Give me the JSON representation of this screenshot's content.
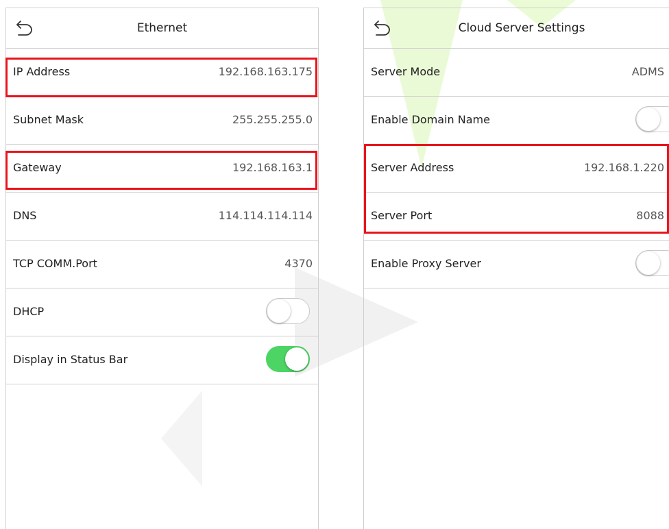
{
  "colors": {
    "highlight": "#e8141b",
    "toggle_on": "#4cd464",
    "divider": "#cfcfcf"
  },
  "left_panel": {
    "title": "Ethernet",
    "back_icon": "back-arrow-icon",
    "rows": [
      {
        "label": "IP Address",
        "value": "192.168.163.175",
        "highlighted": true
      },
      {
        "label": "Subnet Mask",
        "value": "255.255.255.0"
      },
      {
        "label": "Gateway",
        "value": "192.168.163.1",
        "highlighted": true
      },
      {
        "label": "DNS",
        "value": "114.114.114.114"
      },
      {
        "label": "TCP COMM.Port",
        "value": "4370"
      },
      {
        "label": "DHCP",
        "toggle": "off"
      },
      {
        "label": "Display in Status Bar",
        "toggle": "on"
      }
    ]
  },
  "right_panel": {
    "title": "Cloud Server Settings",
    "back_icon": "back-arrow-icon",
    "rows": [
      {
        "label": "Server Mode",
        "value": "ADMS"
      },
      {
        "label": "Enable Domain Name",
        "toggle": "off"
      },
      {
        "label": "Server Address",
        "value": "192.168.1.220",
        "highlighted": true
      },
      {
        "label": "Server Port",
        "value": "8088",
        "highlighted": true
      },
      {
        "label": "Enable Proxy Server",
        "toggle": "off"
      }
    ]
  }
}
